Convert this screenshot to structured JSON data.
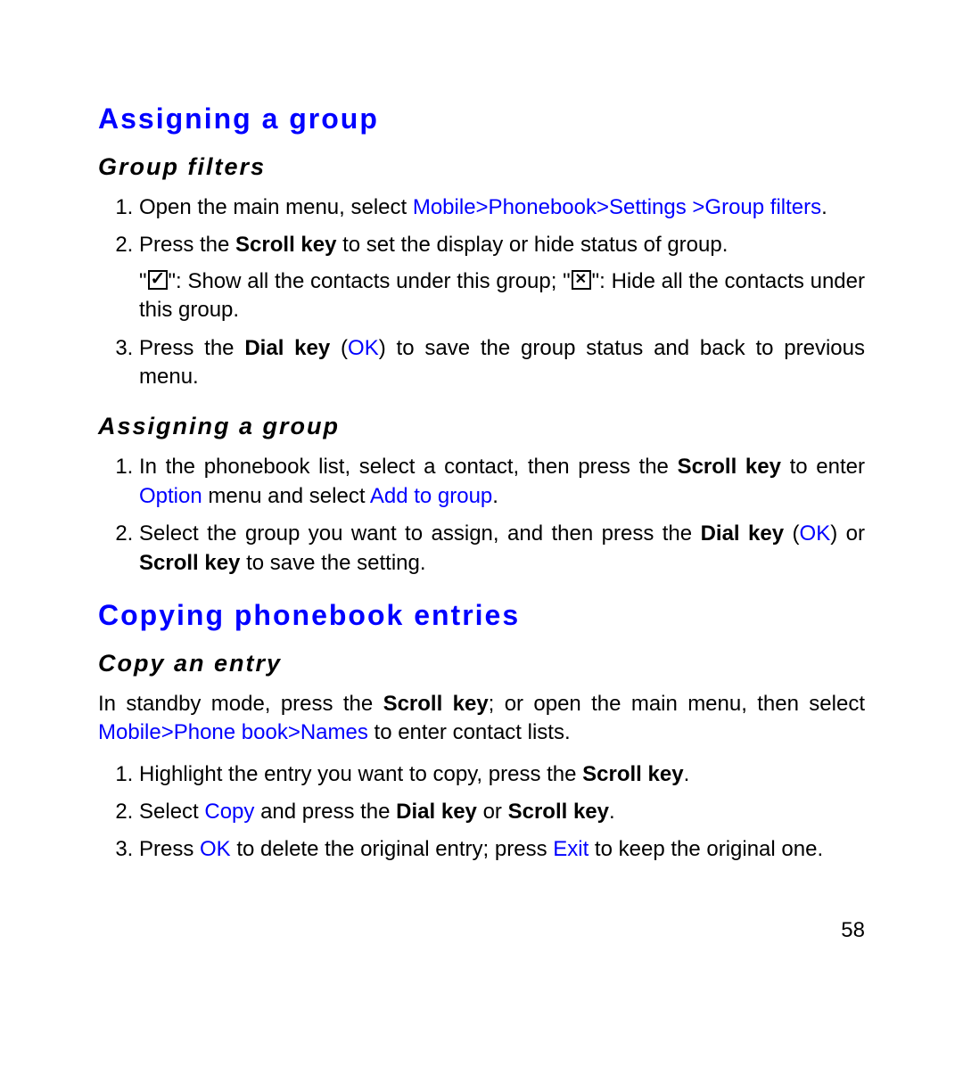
{
  "section1": {
    "heading": "Assigning a group",
    "sub1": {
      "heading": "Group filters",
      "steps": {
        "s1_a": "Open the main menu, select ",
        "s1_b": "Mobile>Phonebook>Settings >Group filters",
        "s1_c": ".",
        "s2_a": "Press the ",
        "s2_b": "Scroll key",
        "s2_c": " to set the display or hide status of group.",
        "s2_note_a": "\"",
        "s2_note_b": "\": Show all the contacts under this group; \"",
        "s2_note_c": "\": Hide all the contacts under this group.",
        "s3_a": "Press the ",
        "s3_b": "Dial key",
        "s3_c": " (",
        "s3_d": "OK",
        "s3_e": ") to save the group status and back to previous menu."
      }
    },
    "sub2": {
      "heading": "Assigning a group",
      "steps": {
        "s1_a": "In the phonebook list, select a contact, then press the ",
        "s1_b": "Scroll key",
        "s1_c": " to enter ",
        "s1_d": "Option",
        "s1_e": " menu and select ",
        "s1_f": "Add to group",
        "s1_g": ".",
        "s2_a": "Select the group you want to assign, and then press the ",
        "s2_b": "Dial key",
        "s2_c": " (",
        "s2_d": "OK",
        "s2_e": ") or ",
        "s2_f": "Scroll key",
        "s2_g": " to save the setting."
      }
    }
  },
  "section2": {
    "heading": "Copying phonebook entries",
    "sub1": {
      "heading": "Copy an entry",
      "intro_a": "In standby mode, press the ",
      "intro_b": "Scroll key",
      "intro_c": "; or open the main menu, then select ",
      "intro_d": "Mobile>Phone book>Names",
      "intro_e": " to enter contact lists.",
      "steps": {
        "s1_a": "Highlight the entry you want to copy, press the ",
        "s1_b": "Scroll key",
        "s1_c": ".",
        "s2_a": "Select ",
        "s2_b": "Copy",
        "s2_c": " and press the ",
        "s2_d": "Dial key",
        "s2_e": " or ",
        "s2_f": "Scroll key",
        "s2_g": ".",
        "s3_a": "Press ",
        "s3_b": "OK",
        "s3_c": " to delete the original entry; press ",
        "s3_d": "Exit",
        "s3_e": " to keep the original one."
      }
    }
  },
  "page_number": "58"
}
